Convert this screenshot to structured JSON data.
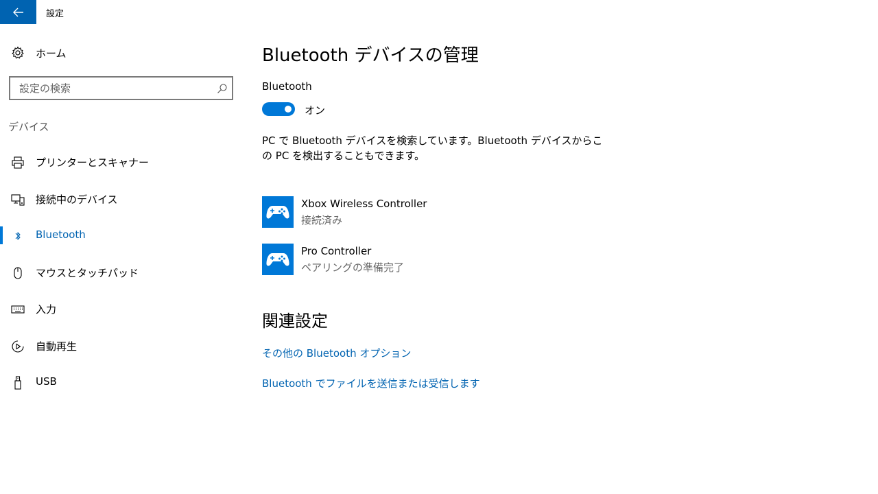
{
  "window": {
    "title": "設定"
  },
  "sidebar": {
    "home_label": "ホーム",
    "search_placeholder": "設定の検索",
    "section": "デバイス",
    "items": [
      {
        "label": "プリンターとスキャナー",
        "icon": "printer-icon"
      },
      {
        "label": "接続中のデバイス",
        "icon": "connected-devices-icon"
      },
      {
        "label": "Bluetooth",
        "icon": "bluetooth-icon",
        "active": true
      },
      {
        "label": "マウスとタッチパッド",
        "icon": "mouse-icon"
      },
      {
        "label": "入力",
        "icon": "keyboard-icon"
      },
      {
        "label": "自動再生",
        "icon": "autoplay-icon"
      },
      {
        "label": "USB",
        "icon": "usb-icon"
      }
    ]
  },
  "main": {
    "title": "Bluetooth デバイスの管理",
    "bluetooth_label": "Bluetooth",
    "toggle_state": "オン",
    "description": "PC で Bluetooth デバイスを検索しています。Bluetooth デバイスからこの PC を検出することもできます。",
    "devices": [
      {
        "name": "Xbox Wireless Controller",
        "status": "接続済み",
        "icon": "gamepad-icon"
      },
      {
        "name": "Pro Controller",
        "status": "ペアリングの準備完了",
        "icon": "gamepad-icon"
      }
    ],
    "related_title": "関連設定",
    "links": [
      "その他の Bluetooth オプション",
      "Bluetooth でファイルを送信または受信します"
    ]
  },
  "colors": {
    "accent": "#0078d7",
    "link": "#0063b1",
    "back_button": "#0063b1"
  }
}
